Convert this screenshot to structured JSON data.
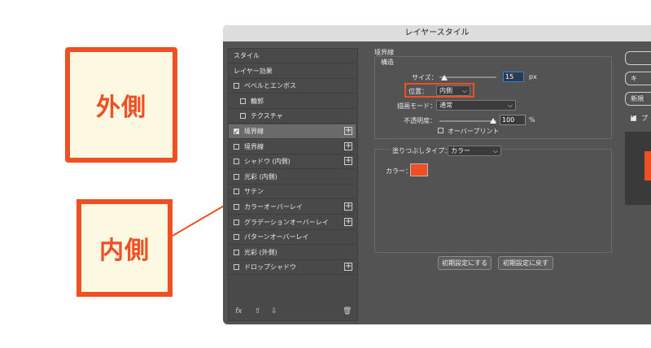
{
  "annotations": {
    "outer_label": "外側",
    "inner_label": "内側"
  },
  "dialog": {
    "title": "レイヤースタイル"
  },
  "left_panel": {
    "items": [
      {
        "label": "スタイル",
        "checkbox": false,
        "checked": false,
        "indent": 0,
        "plus": false,
        "selected": false
      },
      {
        "label": "レイヤー効果",
        "checkbox": false,
        "checked": false,
        "indent": 0,
        "plus": false,
        "selected": false
      },
      {
        "label": "ベベルとエンボス",
        "checkbox": true,
        "checked": false,
        "indent": 0,
        "plus": false,
        "selected": false
      },
      {
        "label": "輪郭",
        "checkbox": true,
        "checked": false,
        "indent": 1,
        "plus": false,
        "selected": false
      },
      {
        "label": "テクスチャ",
        "checkbox": true,
        "checked": false,
        "indent": 1,
        "plus": false,
        "selected": false
      },
      {
        "label": "境界線",
        "checkbox": true,
        "checked": true,
        "indent": 0,
        "plus": true,
        "selected": true
      },
      {
        "label": "境界線",
        "checkbox": true,
        "checked": false,
        "indent": 0,
        "plus": true,
        "selected": false
      },
      {
        "label": "シャドウ (内側)",
        "checkbox": true,
        "checked": false,
        "indent": 0,
        "plus": true,
        "selected": false
      },
      {
        "label": "光彩 (内側)",
        "checkbox": true,
        "checked": false,
        "indent": 0,
        "plus": false,
        "selected": false
      },
      {
        "label": "サテン",
        "checkbox": true,
        "checked": false,
        "indent": 0,
        "plus": false,
        "selected": false
      },
      {
        "label": "カラーオーバーレイ",
        "checkbox": true,
        "checked": false,
        "indent": 0,
        "plus": true,
        "selected": false
      },
      {
        "label": "グラデーションオーバーレイ",
        "checkbox": true,
        "checked": false,
        "indent": 0,
        "plus": true,
        "selected": false
      },
      {
        "label": "パターンオーバーレイ",
        "checkbox": true,
        "checked": false,
        "indent": 0,
        "plus": false,
        "selected": false
      },
      {
        "label": "光彩 (外側)",
        "checkbox": true,
        "checked": false,
        "indent": 0,
        "plus": false,
        "selected": false
      },
      {
        "label": "ドロップシャドウ",
        "checkbox": true,
        "checked": false,
        "indent": 0,
        "plus": true,
        "selected": false
      }
    ],
    "footer": {
      "fx": "fx",
      "up": "⇧",
      "down": "⇩",
      "trash": "🗑"
    }
  },
  "main": {
    "section_title": "境界線",
    "structure_title": "構造",
    "size_label": "サイズ：",
    "size_value": "15",
    "size_unit": "px",
    "position_label": "位置：",
    "position_value": "内側",
    "blend_label": "描画モード：",
    "blend_value": "通常",
    "opacity_label": "不透明度：",
    "opacity_value": "100",
    "opacity_unit": "%",
    "overprint_label": "オーバープリント",
    "fill_type_label": "塗りつぶしタイプ：",
    "fill_type_value": "カラー",
    "color_label": "カラー：",
    "color_hex": "#f04e23",
    "reset_default": "初期設定にする",
    "restore_default": "初期設定に戻す"
  },
  "right_col": {
    "btn2": "キ",
    "btn3": "新規",
    "preview_label": "プ",
    "preview_checked": true
  },
  "colors": {
    "accent": "#f04e23",
    "dialog_bg": "#535353",
    "focus": "#3a82d6"
  }
}
